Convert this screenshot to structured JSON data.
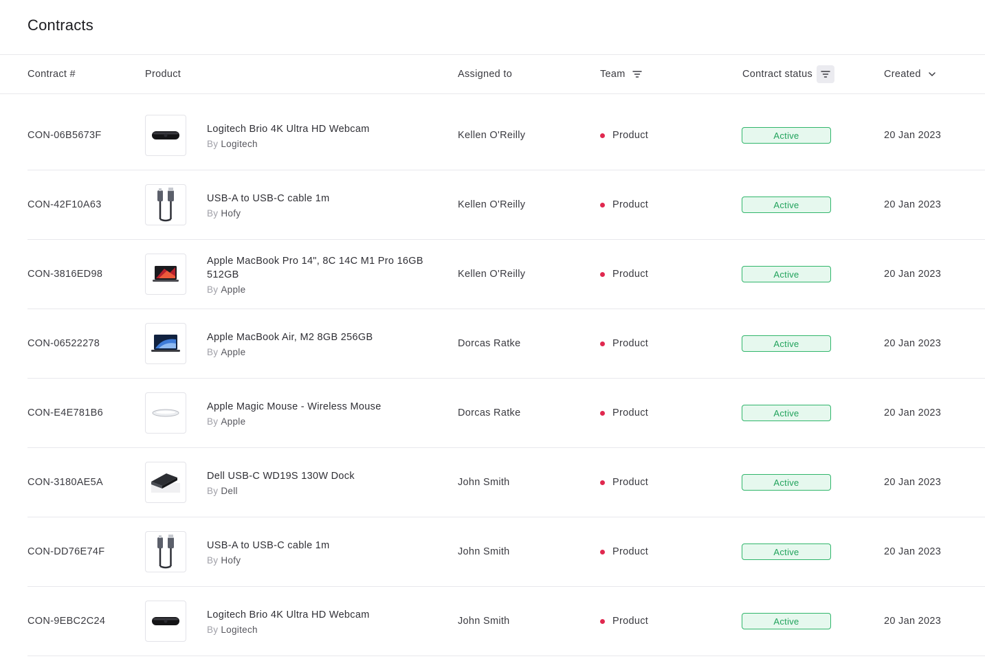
{
  "page": {
    "title": "Contracts"
  },
  "columns": {
    "contract": "Contract #",
    "product": "Product",
    "assigned": "Assigned to",
    "team": "Team",
    "status": "Contract status",
    "created": "Created"
  },
  "by_label": "By",
  "colors": {
    "team_dot": "#e0284f",
    "status_green": "#2fb56a",
    "status_bg": "#e6f8ee"
  },
  "rows": [
    {
      "contract": "CON-06B5673F",
      "product": "Logitech Brio 4K Ultra HD Webcam",
      "brand": "Logitech",
      "icon": "webcam-icon",
      "assigned": "Kellen O'Reilly",
      "team": "Product",
      "status": "Active",
      "created": "20 Jan 2023"
    },
    {
      "contract": "CON-42F10A63",
      "product": "USB-A to USB-C cable 1m",
      "brand": "Hofy",
      "icon": "usb-cable-icon",
      "assigned": "Kellen O'Reilly",
      "team": "Product",
      "status": "Active",
      "created": "20 Jan 2023"
    },
    {
      "contract": "CON-3816ED98",
      "product": "Apple MacBook Pro 14\", 8C 14C M1 Pro 16GB 512GB",
      "brand": "Apple",
      "icon": "macbook-pro-icon",
      "assigned": "Kellen O'Reilly",
      "team": "Product",
      "status": "Active",
      "created": "20 Jan 2023"
    },
    {
      "contract": "CON-06522278",
      "product": "Apple MacBook Air, M2 8GB 256GB",
      "brand": "Apple",
      "icon": "macbook-air-icon",
      "assigned": "Dorcas Ratke",
      "team": "Product",
      "status": "Active",
      "created": "20 Jan 2023"
    },
    {
      "contract": "CON-E4E781B6",
      "product": "Apple Magic Mouse - Wireless Mouse",
      "brand": "Apple",
      "icon": "mouse-icon",
      "assigned": "Dorcas Ratke",
      "team": "Product",
      "status": "Active",
      "created": "20 Jan 2023"
    },
    {
      "contract": "CON-3180AE5A",
      "product": "Dell USB-C WD19S 130W Dock",
      "brand": "Dell",
      "icon": "dock-icon",
      "assigned": "John Smith",
      "team": "Product",
      "status": "Active",
      "created": "20 Jan 2023"
    },
    {
      "contract": "CON-DD76E74F",
      "product": "USB-A to USB-C cable 1m",
      "brand": "Hofy",
      "icon": "usb-cable-icon",
      "assigned": "John Smith",
      "team": "Product",
      "status": "Active",
      "created": "20 Jan 2023"
    },
    {
      "contract": "CON-9EBC2C24",
      "product": "Logitech Brio 4K Ultra HD Webcam",
      "brand": "Logitech",
      "icon": "webcam-icon",
      "assigned": "John Smith",
      "team": "Product",
      "status": "Active",
      "created": "20 Jan 2023"
    }
  ]
}
